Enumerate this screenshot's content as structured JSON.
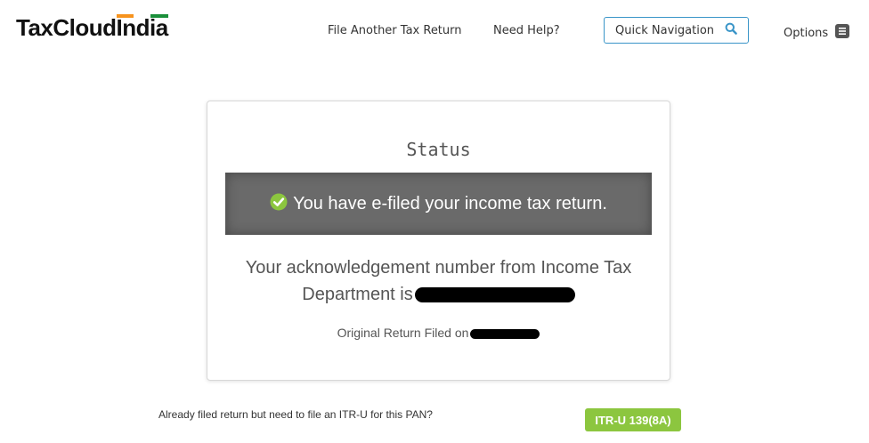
{
  "header": {
    "logo": {
      "part1": "TaxCloud",
      "part2": "India",
      "flag_colors": [
        "#f7931e",
        "#ffffff",
        "#1a8f3a"
      ]
    },
    "nav": {
      "file_another": "File Another Tax Return",
      "need_help": "Need Help?",
      "quick_navigation": "Quick Navigation",
      "options": "Options"
    }
  },
  "status_card": {
    "title": "Status",
    "efiled_message": "You have e-filed your income tax return.",
    "ack_line1": "Your acknowledgement number from Income Tax",
    "ack_line2": "Department is",
    "original_filed_label": "Original Return Filed on"
  },
  "itru": {
    "question": "Already filed return but need to file an ITR-U for this PAN?",
    "button_label": "ITR-U 139(8A)"
  },
  "colors": {
    "accent_blue": "#3a95c8",
    "button_green": "#8cc63f",
    "banner_gray": "#6a6a6a",
    "check_green": "#8cc63f"
  }
}
